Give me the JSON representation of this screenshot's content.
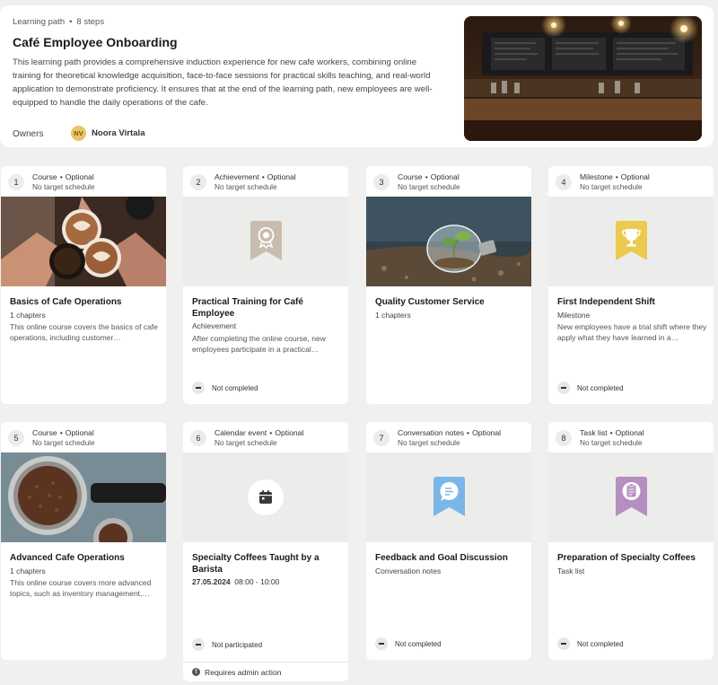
{
  "header": {
    "type_label": "Learning path",
    "steps_label": "8 steps",
    "title": "Café Employee Onboarding",
    "description": "This learning path provides a comprehensive induction experience for new cafe workers, combining online training for theoretical knowledge acquisition, face-to-face sessions for practical skills teaching, and real-world application to demonstrate proficiency. It ensures that at the end of the learning path, new employees are well-equipped to handle the daily operations of the cafe.",
    "owners_label": "Owners",
    "owner": {
      "initials": "NV",
      "name": "Noora Virtala"
    }
  },
  "steps": [
    {
      "num": "1",
      "type": "Course",
      "optional": "Optional",
      "schedule": "No target schedule",
      "title": "Basics of Cafe Operations",
      "subtitle": "1 chapters",
      "description": "This online course covers the basics of cafe operations, including customer…",
      "status": ""
    },
    {
      "num": "2",
      "type": "Achievement",
      "optional": "Optional",
      "schedule": "No target schedule",
      "title": "Practical Training for Café Employee",
      "subtitle": "Achievement",
      "description": "After completing the online course, new employees participate in a practical…",
      "status": "Not completed",
      "badge_color": "#c9bcae",
      "icon": "award-icon"
    },
    {
      "num": "3",
      "type": "Course",
      "optional": "Optional",
      "schedule": "No target schedule",
      "title": "Quality Customer Service",
      "subtitle": "1 chapters",
      "description": "",
      "status": ""
    },
    {
      "num": "4",
      "type": "Milestone",
      "optional": "Optional",
      "schedule": "No target schedule",
      "title": "First Independent Shift",
      "subtitle": "Milestone",
      "description": "New employees have a trial shift where they apply what they have learned in a…",
      "status": "Not completed",
      "badge_color": "#ecc94f",
      "icon": "trophy-icon"
    },
    {
      "num": "5",
      "type": "Course",
      "optional": "Optional",
      "schedule": "No target schedule",
      "title": "Advanced Cafe Operations",
      "subtitle": "1 chapters",
      "description": "This online course covers more advanced topics, such as inventory management,…",
      "status": ""
    },
    {
      "num": "6",
      "type": "Calendar event",
      "optional": "Optional",
      "schedule": "No target schedule",
      "title": "Specialty Coffees Taught by a Barista",
      "date": "27.05.2024",
      "time": "08:00 - 10:00",
      "status": "Not participated",
      "admin_note": "Requires admin action",
      "icon": "calendar-icon"
    },
    {
      "num": "7",
      "type": "Conversation notes",
      "optional": "Optional",
      "schedule": "No target schedule",
      "title": "Feedback and Goal Discussion",
      "subtitle": "Conversation notes",
      "description": "",
      "status": "Not completed",
      "badge_color": "#7ab7e8",
      "icon": "chat-icon"
    },
    {
      "num": "8",
      "type": "Task list",
      "optional": "Optional",
      "schedule": "No target schedule",
      "title": "Preparation of Specialty Coffees",
      "subtitle": "Task list",
      "description": "",
      "status": "Not completed",
      "badge_color": "#b48fc0",
      "icon": "checklist-icon"
    }
  ]
}
